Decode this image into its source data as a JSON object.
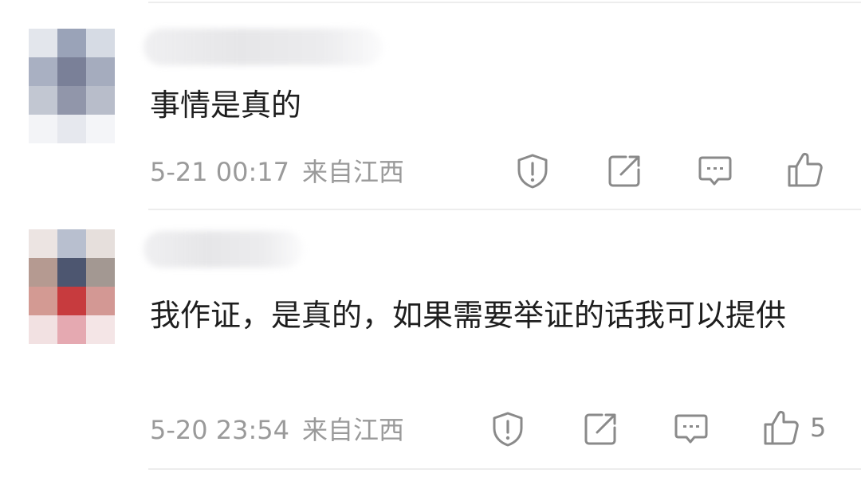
{
  "comments": [
    {
      "text": "事情是真的",
      "time": "5-21 00:17",
      "location": "来自江西",
      "like_count": "",
      "avatar_colors": [
        "#e3e6ec",
        "#9aa3b8",
        "#d6dbe4",
        "#a9b0c2",
        "#7a8098",
        "#a5acbe",
        "#c2c7d2",
        "#9196aa",
        "#b8bdca",
        "#f3f4f7",
        "#e6e8ee",
        "#f4f5f8"
      ]
    },
    {
      "text": "我作证，是真的，如果需要举证的话我可以提供",
      "time": "5-20 23:54",
      "location": "来自江西",
      "like_count": "5",
      "avatar_colors": [
        "#ece4e2",
        "#b8bfcf",
        "#e6dfdc",
        "#b59a91",
        "#4d5670",
        "#a39892",
        "#d39a93",
        "#c73b3e",
        "#d39894",
        "#f2e1e2",
        "#e5a9b1",
        "#f4e5e6"
      ]
    }
  ],
  "actions": [
    "report-icon",
    "share-icon",
    "reply-icon",
    "like-icon"
  ]
}
